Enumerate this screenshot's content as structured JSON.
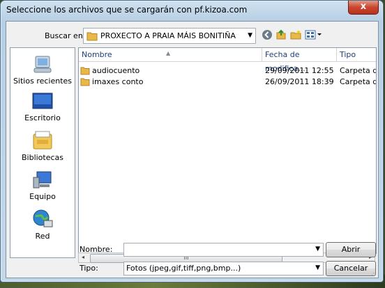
{
  "dialog": {
    "title": "Seleccione los archivos que se cargarán con pf.kizoa.com",
    "close_label": "x"
  },
  "toolbar": {
    "lookin_label": "Buscar en:",
    "lookin_value": "PROXECTO A PRAIA MÁIS BONITIÑA",
    "back_icon": "back-icon",
    "up_icon": "up-folder-icon",
    "newfolder_icon": "new-folder-icon",
    "views_icon": "views-menu-icon"
  },
  "places": [
    {
      "label": "Sitios recientes",
      "icon": "recent-places-icon"
    },
    {
      "label": "Escritorio",
      "icon": "desktop-icon"
    },
    {
      "label": "Bibliotecas",
      "icon": "libraries-icon"
    },
    {
      "label": "Equipo",
      "icon": "computer-icon"
    },
    {
      "label": "Red",
      "icon": "network-icon"
    }
  ],
  "columns": {
    "name": "Nombre",
    "date": "Fecha de modifica...",
    "type": "Tipo"
  },
  "files": [
    {
      "name": "audiocuento",
      "date": "29/09/2011 12:55",
      "type": "Carpeta d"
    },
    {
      "name": "imaxes conto",
      "date": "26/09/2011 18:39",
      "type": "Carpeta d"
    }
  ],
  "scrollbar": {
    "grip": "III",
    "left": "◂",
    "right": "▸"
  },
  "form": {
    "name_label": "Nombre:",
    "name_value": "",
    "type_label": "Tipo:",
    "type_value": "Fotos (jpeg,gif,tiff,png,bmp...)",
    "open_label": "Abrir",
    "cancel_label": "Cancelar"
  },
  "colors": {
    "accent": "#1e3f74",
    "folder": "#e8b84a",
    "close": "#c9462e"
  }
}
